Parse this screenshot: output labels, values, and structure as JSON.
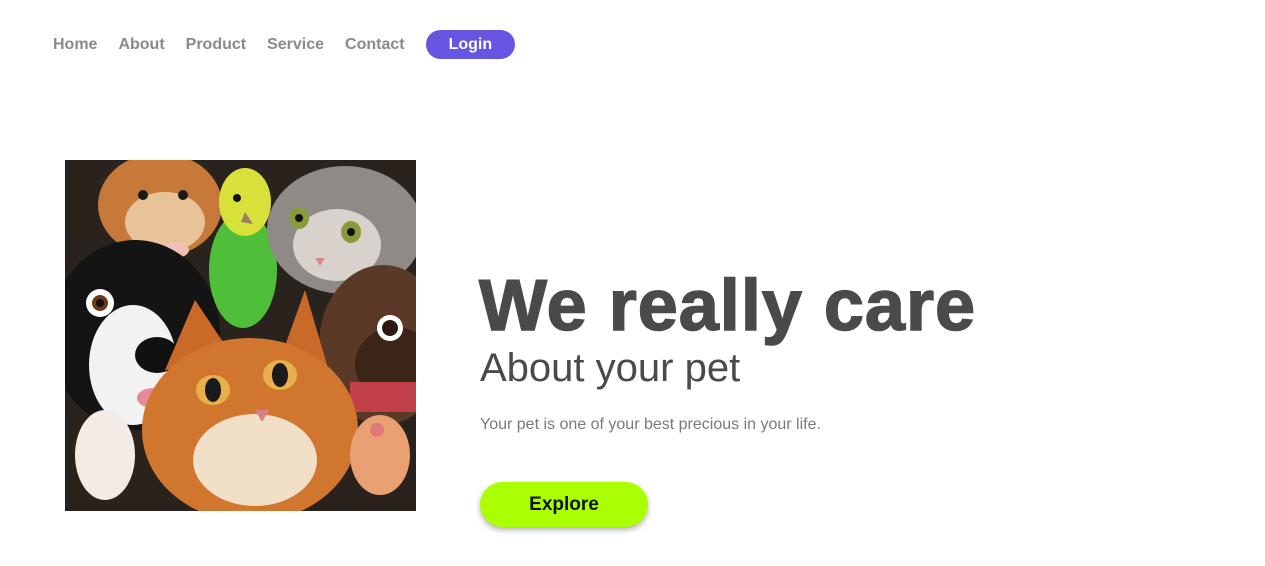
{
  "nav": {
    "items": [
      {
        "label": "Home"
      },
      {
        "label": "About"
      },
      {
        "label": "Product"
      },
      {
        "label": "Service"
      },
      {
        "label": "Contact"
      }
    ],
    "login_label": "Login"
  },
  "hero": {
    "title": "We really care",
    "subtitle": "About your pet",
    "text": "Your pet is one of your best precious in your life.",
    "explore_label": "Explore"
  },
  "colors": {
    "login_bg": "#6555e0",
    "explore_bg": "#aaff00",
    "heading": "#4a4a4a",
    "nav_text": "#8a8a8a"
  }
}
